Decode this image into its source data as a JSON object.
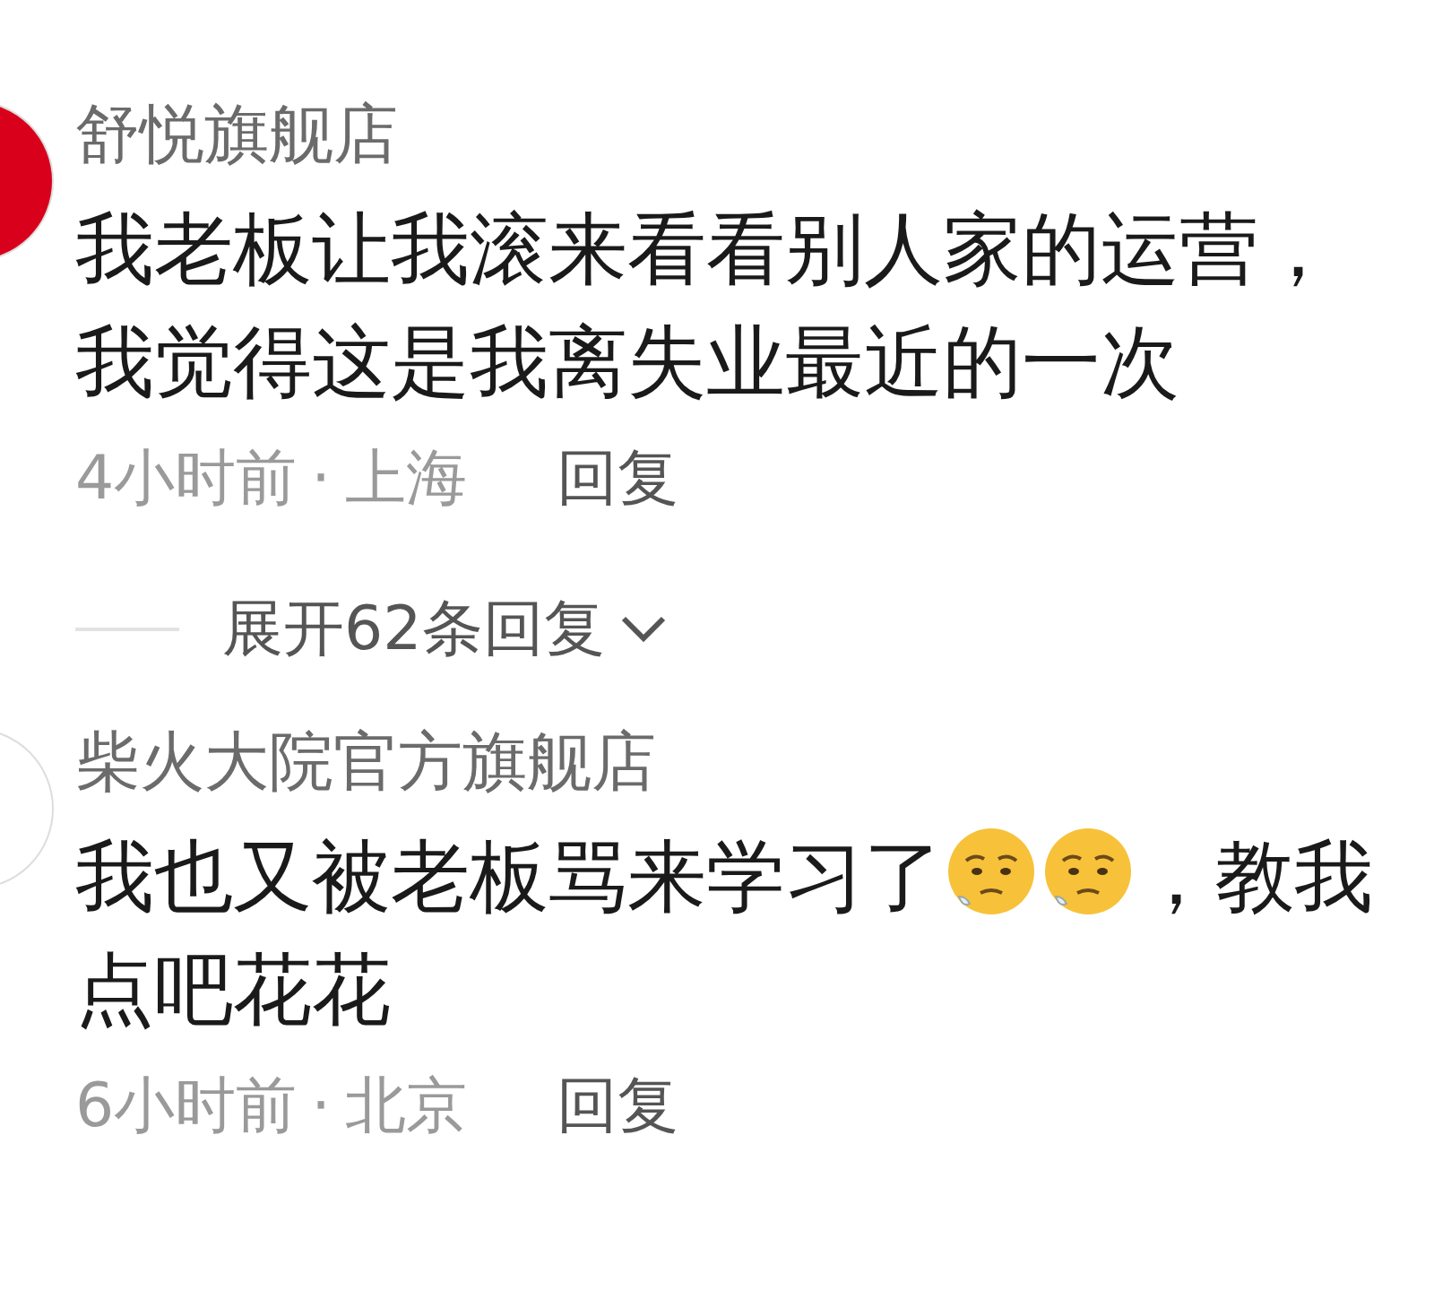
{
  "comments": [
    {
      "avatar": {
        "color": "#d9001b"
      },
      "name": "舒悦旗舰店",
      "segments": [
        {
          "kind": "text",
          "text": "我老板让我滚来看看别人家的运营，我觉得这是我离失业最近的一次"
        }
      ],
      "time": "4小时前",
      "separator": "·",
      "location": "上海",
      "reply": "回复",
      "expand": {
        "label": "展开62条回复"
      }
    },
    {
      "avatar": {
        "color": "#ffffff"
      },
      "name": "柴火大院官方旗舰店",
      "segments": [
        {
          "kind": "text",
          "text": "我也又被老板骂来学习了"
        },
        {
          "kind": "emoji"
        },
        {
          "kind": "emoji"
        },
        {
          "kind": "text",
          "text": "，教我点吧花花"
        }
      ],
      "time": "6小时前",
      "separator": "·",
      "location": "北京",
      "reply": "回复"
    }
  ]
}
